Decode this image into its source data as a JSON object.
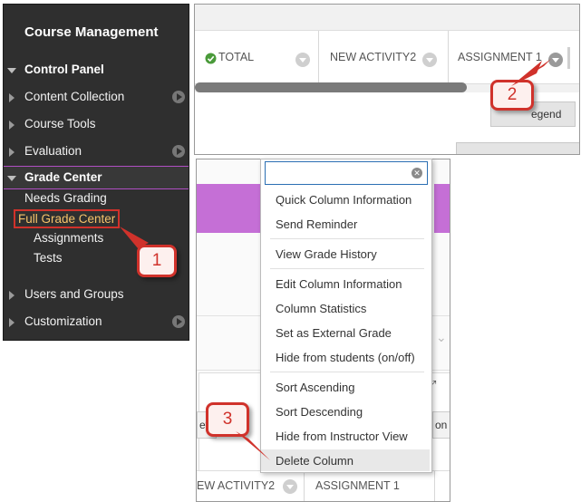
{
  "sidebar": {
    "title": "Course Management",
    "control_panel": "Control Panel",
    "content_collection": "Content Collection",
    "course_tools": "Course Tools",
    "evaluation": "Evaluation",
    "grade_center": "Grade Center",
    "needs_grading": "Needs Grading",
    "full_grade_center": "Full Grade Center",
    "assignments": "Assignments",
    "tests": "Tests",
    "users_and_groups": "Users and Groups",
    "customization": "Customization"
  },
  "grid": {
    "total": "TOTAL",
    "new_activity2": "NEW ACTIVITY2",
    "assignment1": "ASSIGNMENT 1",
    "legend_fragment": "egend",
    "new_activity2_fragment": "EW ACTIVITY2",
    "view_fragment": "ey",
    "on_fragment": "on"
  },
  "menu": {
    "items": [
      "Quick Column Information",
      "Send Reminder",
      "View Grade History",
      "Edit Column Information",
      "Column Statistics",
      "Set as External Grade",
      "Hide from students (on/off)",
      "Sort Ascending",
      "Sort Descending",
      "Hide from Instructor View",
      "Delete Column"
    ]
  },
  "callouts": {
    "one": "1",
    "two": "2",
    "three": "3"
  },
  "colors": {
    "callout": "#d0322b",
    "grade_center_band": "#c56fd6",
    "sidebar_bg": "#2f2f2f"
  }
}
